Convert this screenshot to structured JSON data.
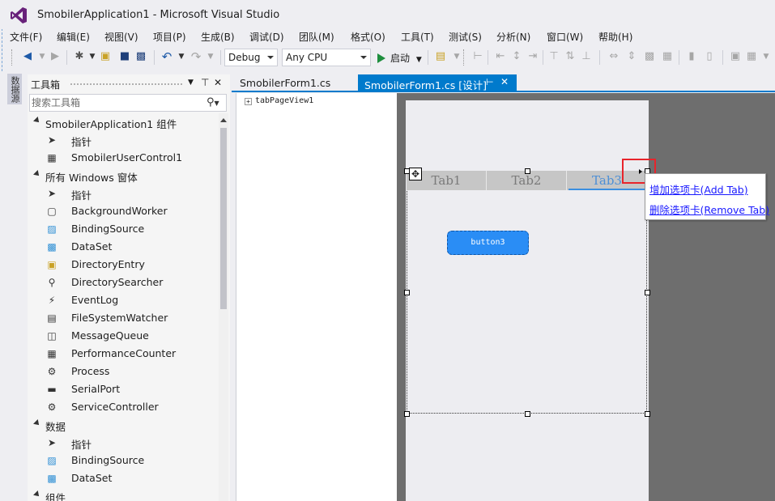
{
  "window": {
    "title": "SmobilerApplication1 - Microsoft Visual Studio",
    "logo_color": "#68217a"
  },
  "menu": [
    "文件(F)",
    "编辑(E)",
    "视图(V)",
    "项目(P)",
    "生成(B)",
    "调试(D)",
    "团队(M)",
    "格式(O)",
    "工具(T)",
    "测试(S)",
    "分析(N)",
    "窗口(W)",
    "帮助(H)"
  ],
  "toolbar": {
    "config": "Debug",
    "platform": "Any CPU",
    "start_label": "启动",
    "icons": [
      "back-icon",
      "forward-icon",
      "new-project-icon",
      "open-icon",
      "save-icon",
      "save-all-icon",
      "undo-icon",
      "redo-icon"
    ]
  },
  "side_strip": {
    "label": "数据源"
  },
  "toolbox": {
    "title": "工具箱",
    "search_placeholder": "搜索工具箱",
    "groups": [
      {
        "label": "SmobilerApplication1 组件",
        "items": [
          {
            "icon": "pointer-icon",
            "label": "指针"
          },
          {
            "icon": "user-control-icon",
            "label": "SmobilerUserControl1"
          }
        ]
      },
      {
        "label": "所有 Windows 窗体",
        "items": [
          {
            "icon": "pointer-icon",
            "label": "指针"
          },
          {
            "icon": "background-worker-icon",
            "label": "BackgroundWorker"
          },
          {
            "icon": "binding-source-icon",
            "label": "BindingSource"
          },
          {
            "icon": "dataset-icon",
            "label": "DataSet"
          },
          {
            "icon": "directory-entry-icon",
            "label": "DirectoryEntry"
          },
          {
            "icon": "directory-searcher-icon",
            "label": "DirectorySearcher"
          },
          {
            "icon": "event-log-icon",
            "label": "EventLog"
          },
          {
            "icon": "file-watcher-icon",
            "label": "FileSystemWatcher"
          },
          {
            "icon": "message-queue-icon",
            "label": "MessageQueue"
          },
          {
            "icon": "performance-counter-icon",
            "label": "PerformanceCounter"
          },
          {
            "icon": "process-icon",
            "label": "Process"
          },
          {
            "icon": "serial-port-icon",
            "label": "SerialPort"
          },
          {
            "icon": "service-controller-icon",
            "label": "ServiceController"
          }
        ]
      },
      {
        "label": "数据",
        "items": [
          {
            "icon": "pointer-icon",
            "label": "指针"
          },
          {
            "icon": "binding-source-icon",
            "label": "BindingSource"
          },
          {
            "icon": "dataset-icon",
            "label": "DataSet"
          }
        ]
      },
      {
        "label": "组件",
        "items": []
      }
    ]
  },
  "doc_tabs": [
    {
      "label": "SmobilerForm1.cs",
      "active": false
    },
    {
      "label": "SmobilerForm1.cs [设计]",
      "active": true
    }
  ],
  "accent": "#007acc",
  "outline": {
    "node": "tabPageView1"
  },
  "designer": {
    "tabs": [
      "Tab1",
      "Tab2",
      "Tab3"
    ],
    "selected_tab": "Tab3",
    "button_label": "button3",
    "button_color": "#2a8df5",
    "smart_tag_highlight": "#e8242b",
    "context_menu": [
      "增加选项卡(Add Tab)",
      "删除选项卡(Remove Tab)"
    ]
  }
}
